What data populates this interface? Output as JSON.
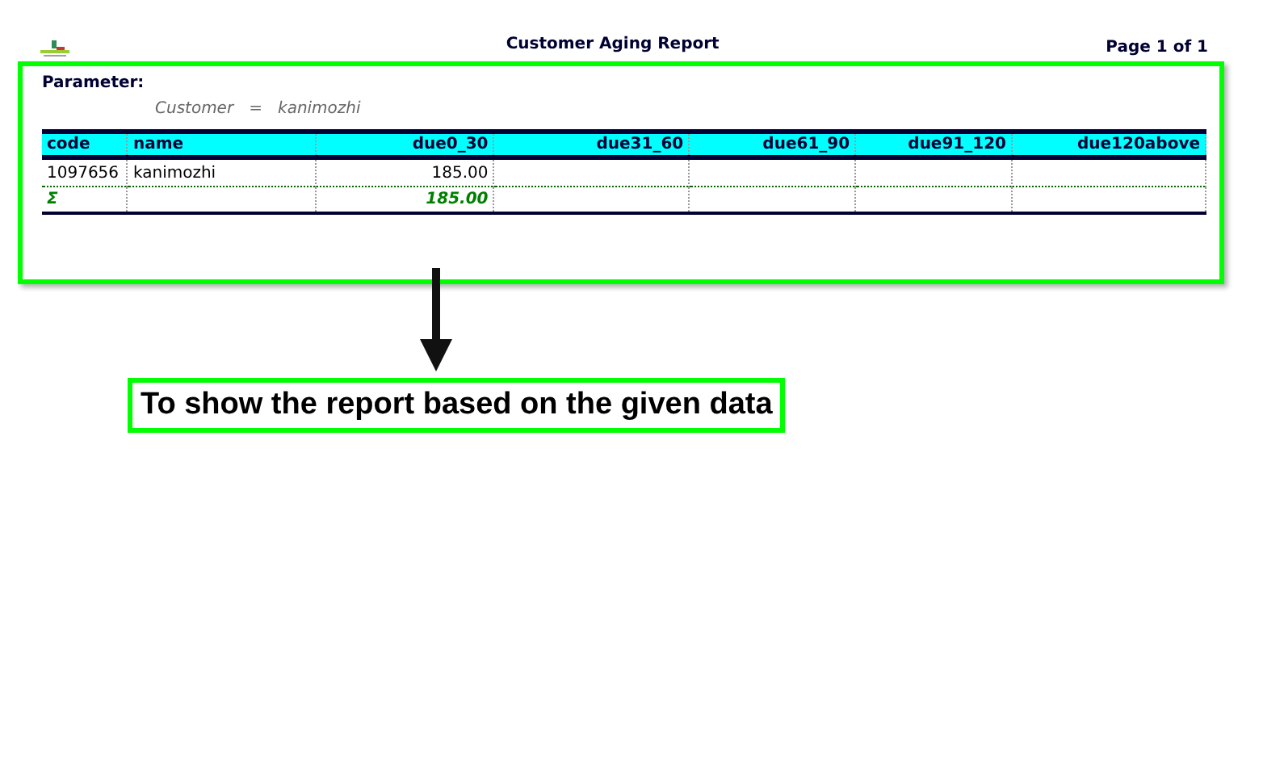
{
  "report": {
    "title": "Customer Aging Report",
    "page": "Page 1 of 1",
    "parameter_heading": "Parameter:",
    "parameters": [
      {
        "label": "Customer",
        "operator": "=",
        "value": "kanimozhi"
      }
    ],
    "columns": [
      {
        "label": "code"
      },
      {
        "label": "name"
      },
      {
        "label": "due0_30"
      },
      {
        "label": "due31_60"
      },
      {
        "label": "due61_90"
      },
      {
        "label": "due91_120"
      },
      {
        "label": "due120above"
      }
    ],
    "rows": [
      {
        "cells": [
          "1097656",
          "kanimozhi",
          "185.00"
        ]
      }
    ],
    "totals": {
      "symbol": "Σ",
      "amount": "185.00"
    }
  },
  "callout": {
    "text": "To show the report based on the given data"
  }
}
